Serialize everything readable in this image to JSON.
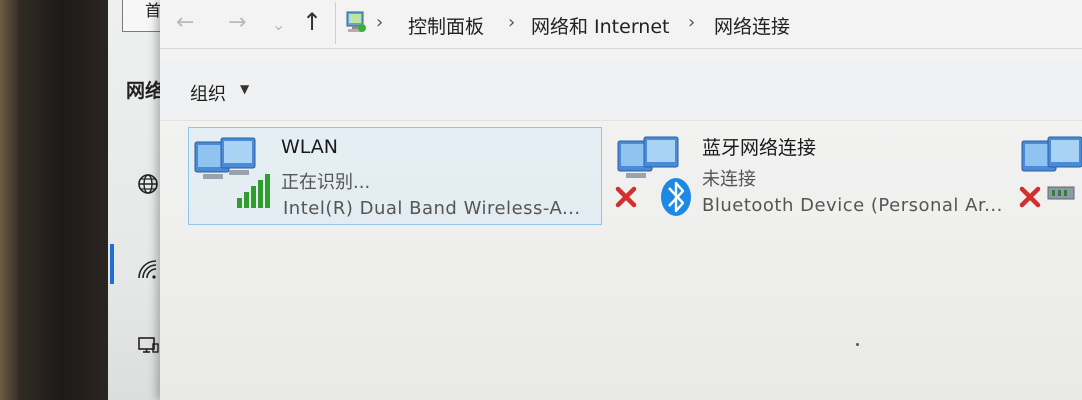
{
  "settings_panel": {
    "home_glyph": "首",
    "heading": "网络",
    "icons": [
      "globe-icon",
      "wifi-icon",
      "ethernet-icon"
    ]
  },
  "nav": {
    "back": "←",
    "forward": "→",
    "recent": "⌄",
    "up": "↑"
  },
  "breadcrumb": {
    "sep": "›",
    "items": [
      "控制面板",
      "网络和 Internet",
      "网络连接"
    ]
  },
  "toolbar": {
    "organize_label": "组织",
    "organize_arrow": "▼"
  },
  "connections": [
    {
      "name": "WLAN",
      "status": "正在识别...",
      "device": "Intel(R) Dual Band Wireless-A...",
      "icon": "wifi-adapter-icon",
      "selected": true
    },
    {
      "name": "蓝牙网络连接",
      "status": "未连接",
      "device": "Bluetooth Device (Personal Ar...",
      "icon": "bluetooth-adapter-icon",
      "disconnected": true
    },
    {
      "name": "",
      "status": "",
      "device": "",
      "icon": "ethernet-adapter-icon",
      "disconnected": true
    }
  ],
  "colors": {
    "accent": "#1f6fd0",
    "selection_border": "#8fc6ea",
    "error_x": "#d32f2f",
    "signal_green": "#2f9e2f",
    "bluetooth": "#1e88e5"
  }
}
